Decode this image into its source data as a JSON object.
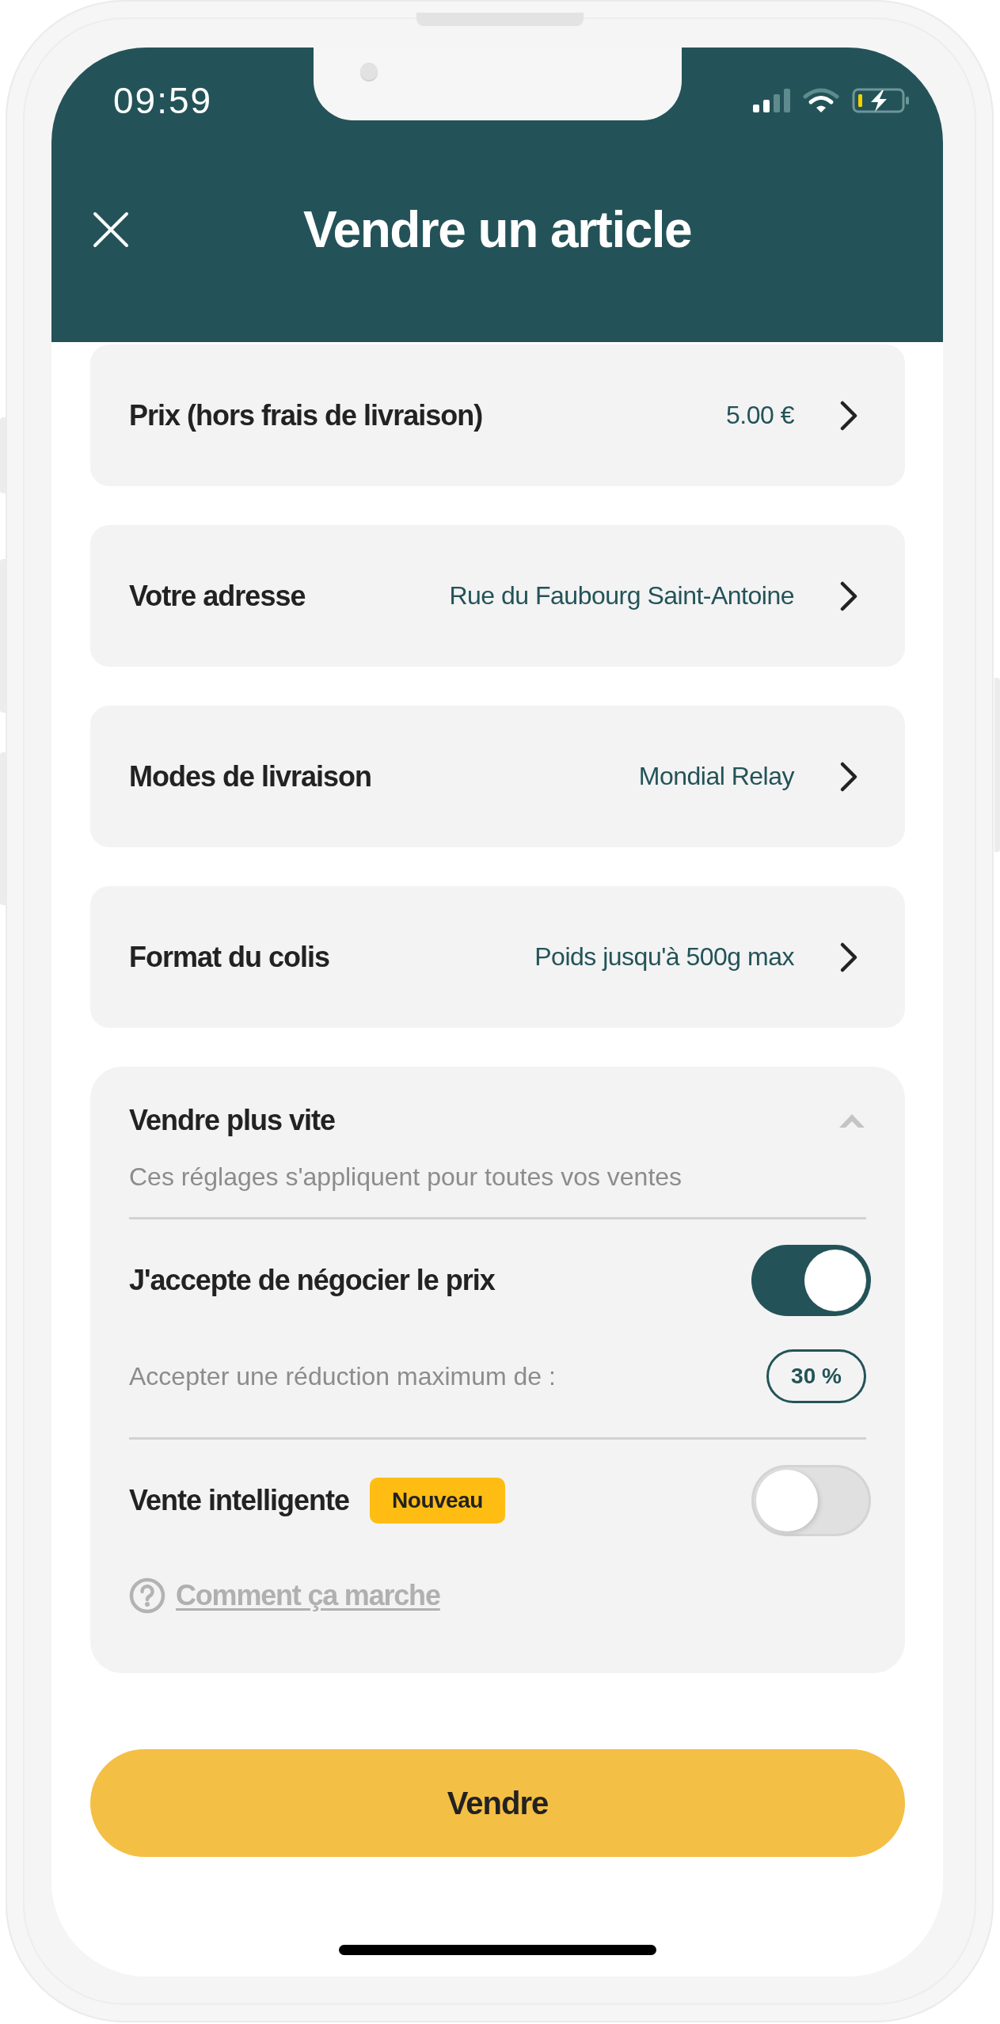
{
  "status_bar": {
    "time": "09:59"
  },
  "header": {
    "title": "Vendre un article"
  },
  "fields": [
    {
      "label": "Prix (hors frais de livraison)",
      "value": "5.00 €"
    },
    {
      "label": "Votre adresse",
      "value": "Rue du Faubourg Saint-Antoine"
    },
    {
      "label": "Modes de livraison",
      "value": "Mondial Relay"
    },
    {
      "label": "Format du colis",
      "value": "Poids jusqu'à 500g max"
    }
  ],
  "sell_faster": {
    "title": "Vendre plus vite",
    "expanded": true,
    "subtitle": "Ces réglages s'appliquent pour toutes vos ventes",
    "negotiate": {
      "label": "J'accepte de négocier le prix",
      "on": true,
      "discount_label": "Accepter une réduction maximum de :",
      "discount_value": "30 %"
    },
    "smart_sale": {
      "label": "Vente intelligente",
      "badge": "Nouveau",
      "on": false,
      "help_link": "Comment ça marche"
    }
  },
  "submit_button": {
    "label": "Vendre"
  }
}
